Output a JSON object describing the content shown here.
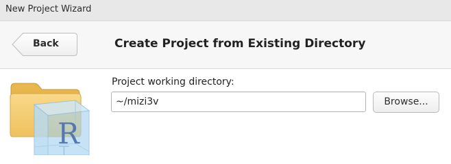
{
  "window": {
    "title": "New Project Wizard"
  },
  "header": {
    "back_label": "Back",
    "title": "Create Project from Existing Directory"
  },
  "form": {
    "directory_label": "Project working directory:",
    "directory_value": "~/mizi3v",
    "browse_label": "Browse..."
  },
  "icons": {
    "back": "chevron-left-button-shape",
    "folder": "folder-with-r-cube-icon",
    "r_logo_letter": "R"
  },
  "colors": {
    "titlebar_bg": "#e8e8e8",
    "header_bg": "#f7f7f7",
    "folder_yellow": "#f0c869",
    "cube_blue": "#8ec3e6"
  }
}
